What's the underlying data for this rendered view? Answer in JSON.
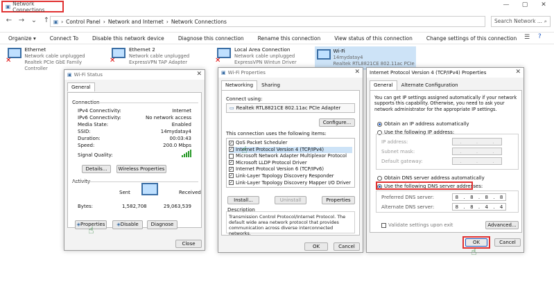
{
  "window": {
    "title": "Network Connections",
    "min": "—",
    "max": "▢",
    "close": "✕"
  },
  "address": {
    "path": [
      "Control Panel",
      "Network and Internet",
      "Network Connections"
    ],
    "search_placeholder": "Search Network ..."
  },
  "commands": [
    "Organize ▾",
    "Connect To",
    "Disable this network device",
    "Diagnose this connection",
    "Rename this connection",
    "View status of this connection",
    "Change settings of this connection"
  ],
  "connections": [
    {
      "name": "Ethernet",
      "status": "Network cable unplugged",
      "device": "Realtek PCIe GbE Family Controller"
    },
    {
      "name": "Ethernet 2",
      "status": "Network cable unplugged",
      "device": "ExpressVPN TAP Adapter"
    },
    {
      "name": "Local Area Connection",
      "status": "Network cable unplugged",
      "device": "ExpressVPN Wintun Driver"
    },
    {
      "name": "Wi-Fi",
      "status": "14mydatay4",
      "device": "Realtek RTL8821CE 802.11ac PCIe ..."
    }
  ],
  "wifi_status": {
    "title": "Wi-Fi Status",
    "tab": "General",
    "connection_label": "Connection",
    "rows": [
      {
        "label": "IPv4 Connectivity:",
        "value": "Internet"
      },
      {
        "label": "IPv6 Connectivity:",
        "value": "No network access"
      },
      {
        "label": "Media State:",
        "value": "Enabled"
      },
      {
        "label": "SSID:",
        "value": "14mydatay4"
      },
      {
        "label": "Duration:",
        "value": "00:03:43"
      },
      {
        "label": "Speed:",
        "value": "200.0 Mbps"
      }
    ],
    "signal_label": "Signal Quality:",
    "details": "Details...",
    "wireless_props": "Wireless Properties",
    "activity_label": "Activity",
    "sent": "Sent",
    "received": "Received",
    "bytes_label": "Bytes:",
    "bytes_sent": "1,582,708",
    "bytes_received": "29,063,539",
    "properties": "Properties",
    "disable": "Disable",
    "diagnose": "Diagnose",
    "close": "Close"
  },
  "wifi_props": {
    "title": "Wi-Fi Properties",
    "tabs": [
      "Networking",
      "Sharing"
    ],
    "connect_using": "Connect using:",
    "adapter": "Realtek RTL8821CE 802.11ac PCIe Adapter",
    "configure": "Configure...",
    "items_label": "This connection uses the following items:",
    "items": [
      "QoS Packet Scheduler",
      "Internet Protocol Version 4 (TCP/IPv4)",
      "Microsoft Network Adapter Multiplexor Protocol",
      "Microsoft LLDP Protocol Driver",
      "Internet Protocol Version 6 (TCP/IPv6)",
      "Link-Layer Topology Discovery Responder",
      "Link-Layer Topology Discovery Mapper I/O Driver"
    ],
    "install": "Install...",
    "uninstall": "Uninstall",
    "properties": "Properties",
    "description_label": "Description",
    "description": "Transmission Control Protocol/Internet Protocol. The default wide area network protocol that provides communication across diverse interconnected networks.",
    "ok": "OK",
    "cancel": "Cancel"
  },
  "ipv4": {
    "title": "Internet Protocol Version 4 (TCP/IPv4) Properties",
    "tabs": [
      "General",
      "Alternate Configuration"
    ],
    "intro": "You can get IP settings assigned automatically if your network supports this capability. Otherwise, you need to ask your network administrator for the appropriate IP settings.",
    "obtain_ip": "Obtain an IP address automatically",
    "use_ip": "Use the following IP address:",
    "ip_label": "IP address:",
    "mask_label": "Subnet mask:",
    "gateway_label": "Default gateway:",
    "obtain_dns": "Obtain DNS server address automatically",
    "use_dns": "Use the following DNS server addresses:",
    "preferred_label": "Preferred DNS server:",
    "alternate_label": "Alternate DNS server:",
    "preferred": [
      "8",
      "8",
      "8",
      "8"
    ],
    "alternate": [
      "8",
      "8",
      "4",
      "4"
    ],
    "validate": "Validate settings upon exit",
    "advanced": "Advanced...",
    "ok": "OK",
    "cancel": "Cancel"
  }
}
